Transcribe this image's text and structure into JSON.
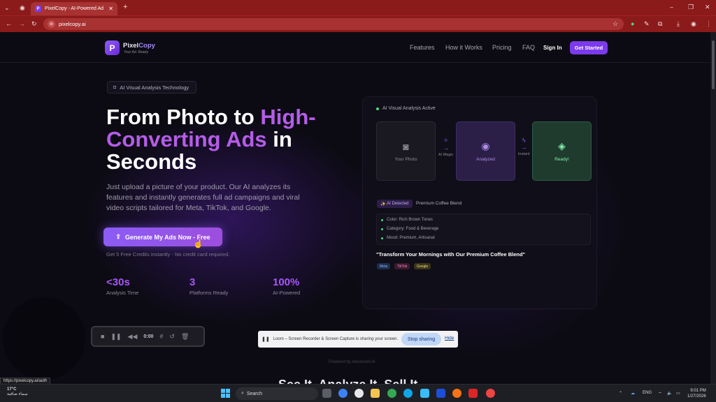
{
  "browser": {
    "tab_title": "PixelCopy - AI-Powered Ad",
    "tab_icon": "P",
    "url": "pixelcopy.ai",
    "status_url": "https://pixelcopy.ai/auth"
  },
  "nav": {
    "logo_letter": "P",
    "logo_name_a": "Pixel",
    "logo_name_b": "Copy",
    "logo_tagline": "Your Ad. Ready.",
    "links": [
      "Features",
      "How it Works",
      "Pricing",
      "FAQ"
    ],
    "sign_in": "Sign In",
    "get_started": "Get Started"
  },
  "hero": {
    "badge": "AI Visual Analysis Technology",
    "title_1": "From Photo to ",
    "title_grad": "High-Converting Ads",
    "title_2": " in Seconds",
    "subtitle": "Just upload a picture of your product. Our AI analyzes its features and instantly generates full ad campaigns and viral video scripts tailored for Meta, TikTok, and Google.",
    "cta": "Generate My Ads Now - Free",
    "cta_note": "Get 5 Free Credits instantly - No credit card required.",
    "stats": [
      {
        "value": "<30s",
        "label": "Analysis Time"
      },
      {
        "value": "3",
        "label": "Platforms Ready"
      },
      {
        "value": "100%",
        "label": "AI-Powered"
      }
    ]
  },
  "demo": {
    "status": "AI Visual Analysis Active",
    "steps": [
      "Your Photo",
      "Analyzed",
      "Ready!"
    ],
    "arrows": [
      "AI Magic",
      "Instant"
    ],
    "detected_tag": "AI Detected",
    "detected_name": "Premium Coffee Blend",
    "attributes": [
      "Color: Rich Brown Tones",
      "Category: Food & Beverage",
      "Mood: Premium, Artisanal"
    ],
    "quote": "\"Transform Your Mornings with Our Premium Coffee Blend\"",
    "platforms": [
      "Meta",
      "TikTok",
      "Google"
    ]
  },
  "below": {
    "faint": "Powered by Advanced AI",
    "big": "See It. Analyze It. Sell It."
  },
  "loom": {
    "time": "0:00",
    "message": "Loom – Screen Recorder & Screen Capture is sharing your screen.",
    "stop": "Stop sharing",
    "hide": "Hide"
  },
  "taskbar": {
    "temp": "17°C",
    "weather": "سماء صافية",
    "search": "Search",
    "lang": "ENG",
    "time": "9:01 PM",
    "date": "1/27/2026"
  },
  "colors": {
    "accent": "#7c3aed",
    "browser_frame": "#8b1a1a",
    "ready_green": "#86efac"
  }
}
